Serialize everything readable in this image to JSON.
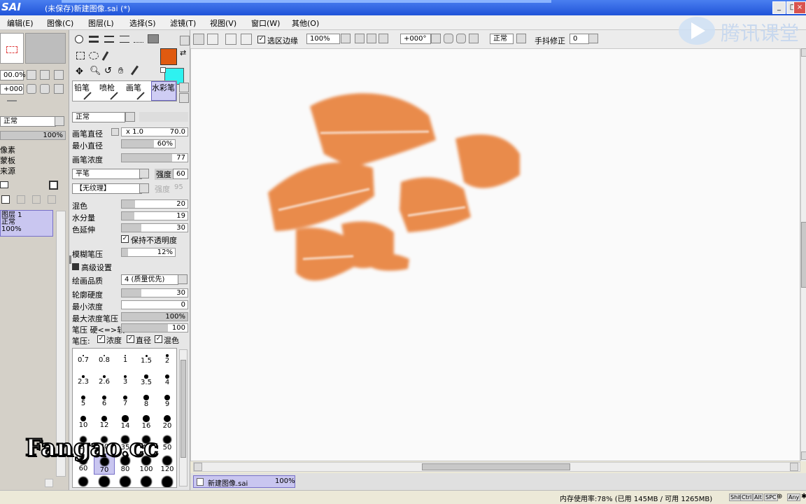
{
  "app": {
    "logo": "SAI",
    "title": "(未保存)新建图像.sai (*)",
    "caption_buttons": [
      "_",
      "□",
      "×"
    ]
  },
  "menu": [
    "编辑(E)",
    "图像(C)",
    "图层(L)",
    "选择(S)",
    "滤镜(T)",
    "视图(V)",
    "窗口(W)",
    "其他(O)"
  ],
  "watermarks": {
    "tencent": "腾讯课堂",
    "fangao": "Fangao.cc"
  },
  "left": {
    "zoom": "00.0%",
    "rotate": "+000",
    "blend": "正常",
    "opacity": "100%",
    "items": [
      "像素",
      "蒙板",
      "来源"
    ],
    "layer": {
      "name": "图层 1",
      "mode": "正常",
      "opacity": "100%"
    }
  },
  "colors": {
    "primary": "#e05a10",
    "secondary": "#2ef2f0",
    "stroke": "#e8823e"
  },
  "tools": {
    "tabs": [
      "铅笔",
      "喷枪",
      "画笔",
      "水彩笔"
    ],
    "mode": "正常",
    "brush_size": {
      "label": "画笔直径",
      "mult": "x 1.0",
      "value": "70.0"
    },
    "min_size": {
      "label": "最小直径",
      "value": "60%",
      "pct": 60
    },
    "density": {
      "label": "画笔浓度",
      "value": "77",
      "pct": 77
    },
    "shape": "平笔",
    "strength_label": "强度",
    "strength": "60",
    "texture": "【无纹理】",
    "texture_strength_label": "强度",
    "texture_strength": "95",
    "blending": {
      "label": "混色",
      "value": "20",
      "pct": 20
    },
    "water": {
      "label": "水分量",
      "value": "19",
      "pct": 19
    },
    "persistence": {
      "label": "色延伸",
      "value": "30",
      "pct": 30
    },
    "keep_opacity": "保持不透明度",
    "blur_pressure": {
      "label": "模糊笔压",
      "value": "12%",
      "pct": 12
    },
    "advanced": "高级设置",
    "quality_label": "绘画品质",
    "quality": "4 (质量优先)",
    "edge_hardness": {
      "label": "轮廓硬度",
      "value": "30",
      "pct": 30
    },
    "min_density": {
      "label": "最小浓度",
      "value": "0",
      "pct": 0
    },
    "max_density_pressure": {
      "label": "最大浓度笔压",
      "value": "100%",
      "pct": 100
    },
    "pressure_hardness": {
      "label": "笔压 硬<=>软",
      "value": "100",
      "pct": 100
    },
    "pressure_label": "笔压:",
    "pressure_density": "浓度",
    "pressure_size": "直径",
    "pressure_blend": "混色",
    "sizes": [
      [
        "0.7",
        "0.8",
        "1",
        "1.5",
        "2"
      ],
      [
        "2.3",
        "2.6",
        "3",
        "3.5",
        "4"
      ],
      [
        "5",
        "6",
        "7",
        "8",
        "9"
      ],
      [
        "10",
        "12",
        "14",
        "16",
        "20"
      ],
      [
        "25",
        "30",
        "35",
        "40",
        "50"
      ],
      [
        "60",
        "70",
        "80",
        "100",
        "120"
      ],
      [
        "",
        "",
        "",
        "",
        ""
      ]
    ]
  },
  "canvas_toolbar": {
    "selection_edge": "选区边缘",
    "zoom": "100%",
    "angle": "+000°",
    "mode": "正常",
    "stabilizer_label": "手抖修正",
    "stabilizer": "0"
  },
  "doc_tab": {
    "name": "新建图像.sai",
    "zoom": "100%"
  },
  "status": {
    "memory": "内存使用率:78% (已用 145MB / 可用 1265MB)",
    "keys": [
      "Shift",
      "Ctrl",
      "Alt",
      "SPC",
      "Any"
    ]
  }
}
